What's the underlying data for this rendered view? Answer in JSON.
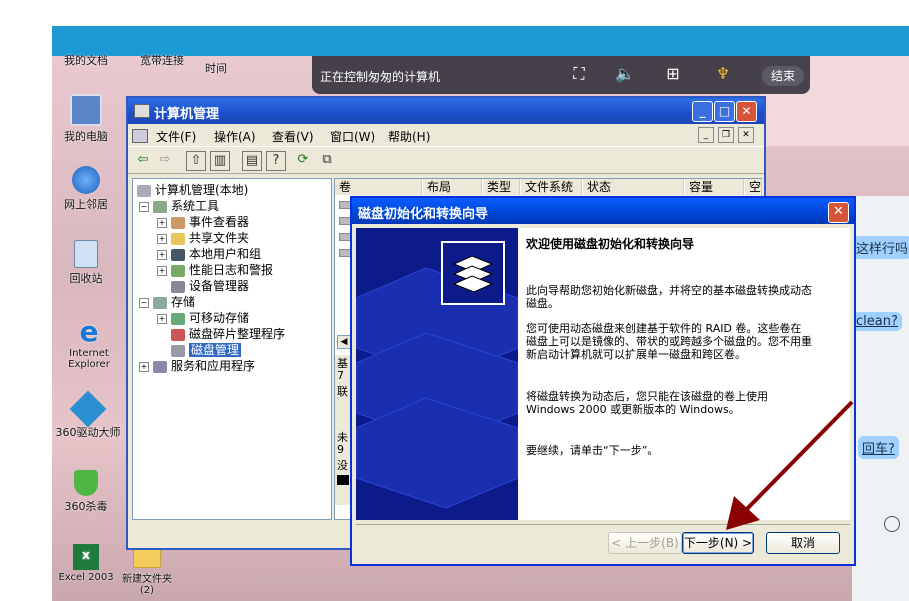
{
  "desktop": {
    "icons": [
      {
        "label": "我的文档"
      },
      {
        "label": "宽带连接"
      },
      {
        "label": "时间"
      },
      {
        "label": "我的电脑"
      },
      {
        "label": "网上邻居"
      },
      {
        "label": "回收站"
      },
      {
        "label": "Internet Explorer"
      },
      {
        "label": "360驱动大师"
      },
      {
        "label": "360杀毒"
      },
      {
        "label": "Excel 2003"
      },
      {
        "label": "新建文件夹 (2)"
      }
    ]
  },
  "remote_bar": {
    "status_text": "正在控制匆匆的计算机",
    "end_label": "结束"
  },
  "chat": {
    "bubbles": [
      "这样行吗",
      "clean?",
      "回车?"
    ]
  },
  "comp_mgmt": {
    "title": "计算机管理",
    "menu": [
      "文件(F)",
      "操作(A)",
      "查看(V)",
      "窗口(W)",
      "帮助(H)"
    ],
    "tree": {
      "root": "计算机管理(本地)",
      "system_tools": "系统工具",
      "event_viewer": "事件查看器",
      "shared_folders": "共享文件夹",
      "local_users": "本地用户和组",
      "perf_logs": "性能日志和警报",
      "device_manager": "设备管理器",
      "storage": "存储",
      "removable_storage": "可移动存储",
      "defrag": "磁盘碎片整理程序",
      "disk_mgmt": "磁盘管理",
      "services": "服务和应用程序"
    },
    "columns": [
      "卷",
      "布局",
      "类型",
      "文件系统",
      "状态",
      "容量",
      "空"
    ],
    "fragments": [
      "基",
      "7",
      "联",
      "未",
      "9",
      "没"
    ]
  },
  "wizard": {
    "title": "磁盘初始化和转换向导",
    "heading": "欢迎使用磁盘初始化和转换向导",
    "p1": "此向导帮助您初始化新磁盘，并将空的基本磁盘转换成动态磁盘。",
    "p2": "您可使用动态磁盘来创建基于软件的 RAID 卷。这些卷在磁盘上可以是镜像的、带状的或跨越多个磁盘的。您不用重新启动计算机就可以扩展单一磁盘和跨区卷。",
    "p3": "将磁盘转换为动态后，您只能在该磁盘的卷上使用 Windows 2000 或更新版本的 Windows。",
    "p4": "要继续，请单击“下一步”。",
    "back_label": "< 上一步(B)",
    "next_label": "下一步(N) >",
    "cancel_label": "取消"
  },
  "colors": {
    "xp_title_blue": "#2f6fe6",
    "dialog_side_navy": "#0c1a8a",
    "annotation_arrow": "#8b0000",
    "top_bar_blue": "#1b9ad6"
  }
}
